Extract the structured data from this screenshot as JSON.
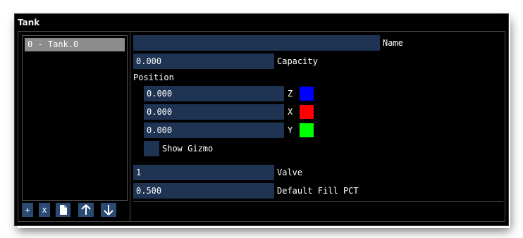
{
  "panel": {
    "title": "Tank"
  },
  "list": {
    "items": [
      {
        "label": "0 - Tank.0"
      }
    ],
    "buttons": [
      {
        "label": "+"
      },
      {
        "label": "x"
      }
    ]
  },
  "form": {
    "name": {
      "label": "Name",
      "value": ""
    },
    "capacity": {
      "label": "Capacity",
      "value": "0.000"
    },
    "position": {
      "label": "Position",
      "z": {
        "label": "Z",
        "value": "0.000",
        "color": "#0000ff"
      },
      "x": {
        "label": "X",
        "value": "0.000",
        "color": "#ff0000"
      },
      "y": {
        "label": "Y",
        "value": "0.000",
        "color": "#00ff00"
      },
      "show_gizmo": {
        "label": "Show Gizmo",
        "checked": false
      }
    },
    "valve": {
      "label": "Valve",
      "value": "1"
    },
    "default_fill_pct": {
      "label": "Default Fill PCT",
      "value": "0.500"
    }
  }
}
